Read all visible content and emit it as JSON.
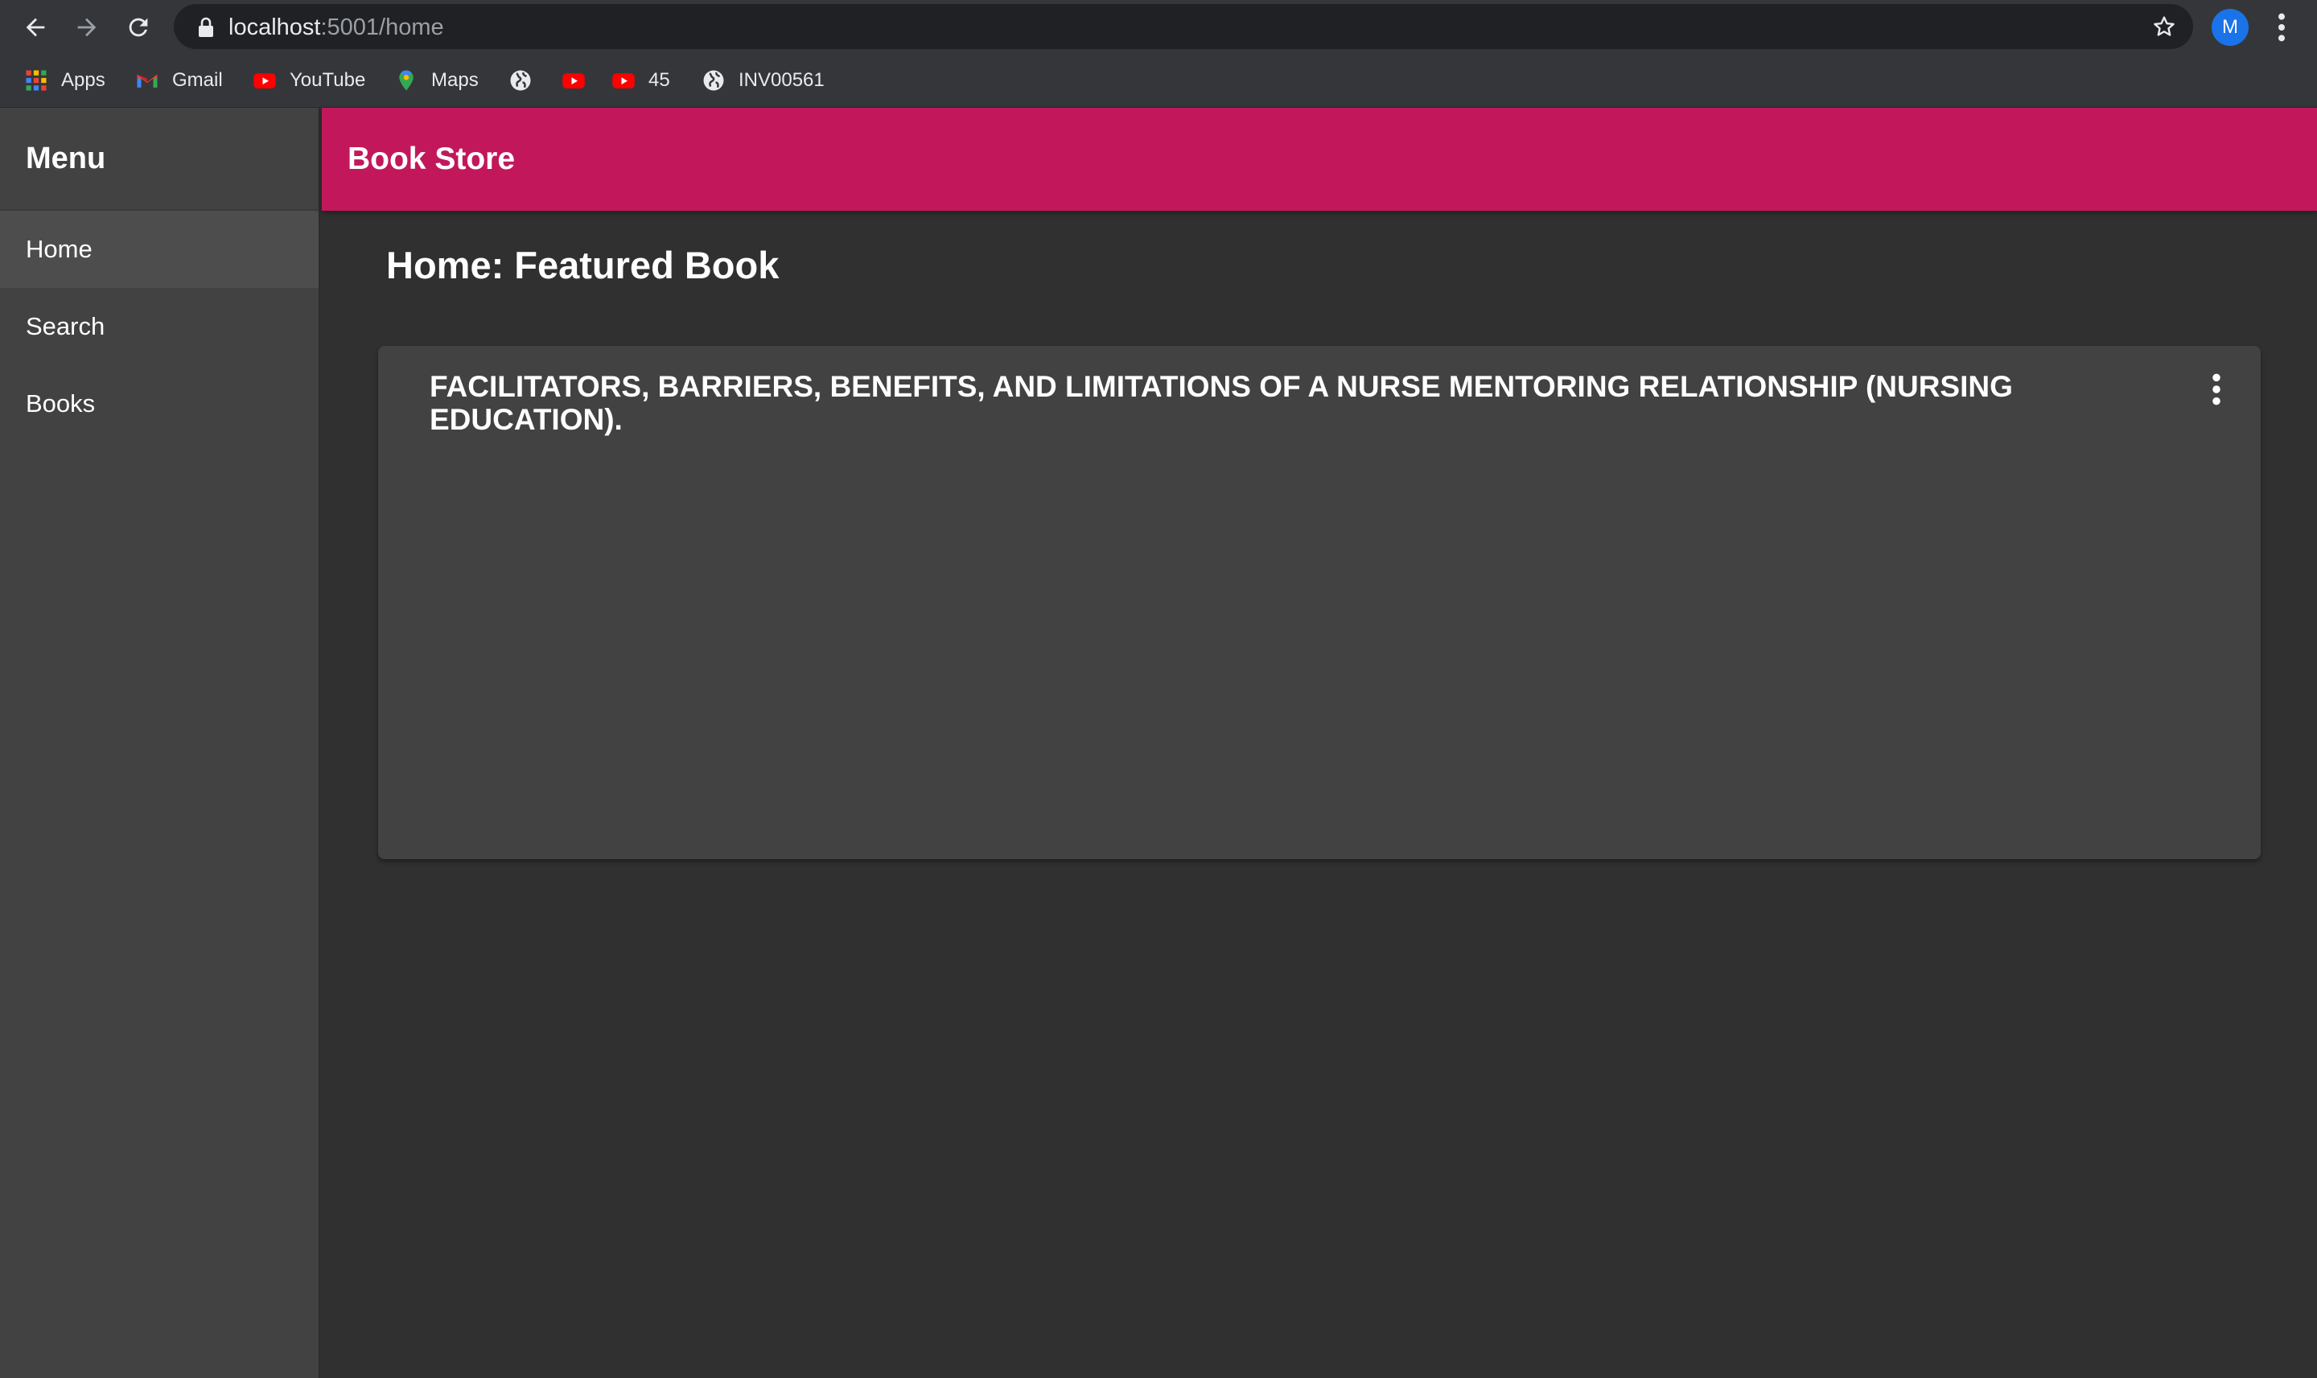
{
  "browser": {
    "url_host": "localhost",
    "url_rest": ":5001/home",
    "profile_initial": "M",
    "bookmarks": [
      {
        "label": "Apps",
        "icon": "apps-grid-icon"
      },
      {
        "label": "Gmail",
        "icon": "gmail-icon"
      },
      {
        "label": "YouTube",
        "icon": "youtube-icon"
      },
      {
        "label": "Maps",
        "icon": "maps-icon"
      },
      {
        "label": "",
        "icon": "globe-icon"
      },
      {
        "label": "",
        "icon": "youtube-icon"
      },
      {
        "label": "45",
        "icon": "youtube-icon"
      },
      {
        "label": "INV00561",
        "icon": "globe-icon"
      }
    ]
  },
  "sidebar": {
    "title": "Menu",
    "items": [
      {
        "label": "Home",
        "active": true
      },
      {
        "label": "Search",
        "active": false
      },
      {
        "label": "Books",
        "active": false
      }
    ]
  },
  "appbar": {
    "title": "Book Store"
  },
  "main": {
    "heading": "Home: Featured Book",
    "featured_book": {
      "title": "FACILITATORS, BARRIERS, BENEFITS, AND LIMITATIONS OF A NURSE MENTORING RELATIONSHIP (NURSING EDUCATION)."
    }
  },
  "colors": {
    "accent": "#c2185b",
    "background": "#303030",
    "surface": "#424242"
  }
}
